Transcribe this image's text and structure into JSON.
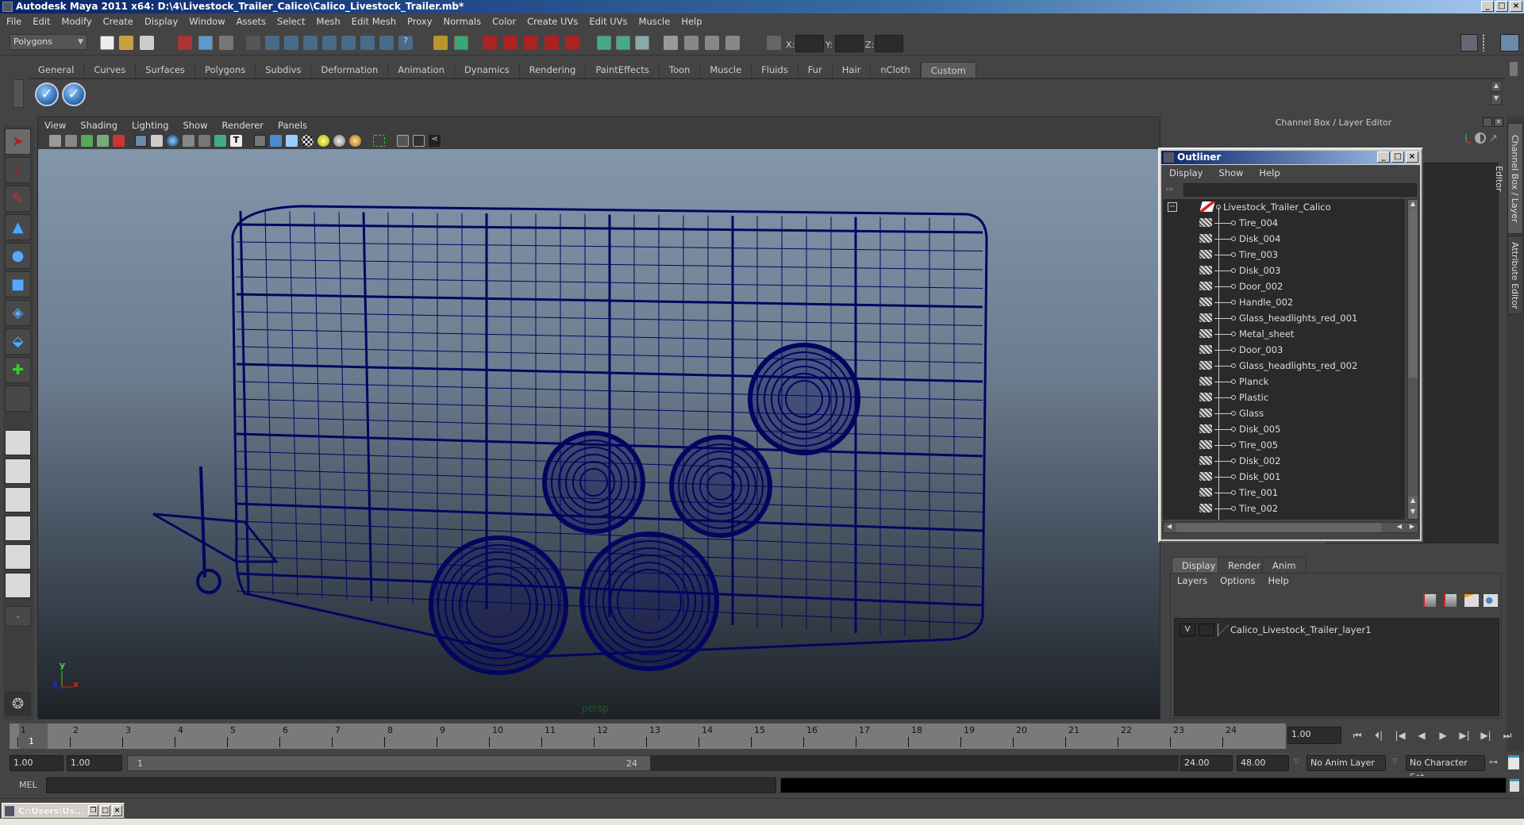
{
  "window": {
    "title": "Autodesk Maya 2011 x64: D:\\4\\Livestock_Trailer_Calico\\Calico_Livestock_Trailer.mb*",
    "controls": [
      "_",
      "□",
      "×"
    ]
  },
  "menubar": [
    "File",
    "Edit",
    "Modify",
    "Create",
    "Display",
    "Window",
    "Assets",
    "Select",
    "Mesh",
    "Edit Mesh",
    "Proxy",
    "Normals",
    "Color",
    "Create UVs",
    "Edit UVs",
    "Muscle",
    "Help"
  ],
  "statusline": {
    "mode": "Polygons",
    "coord_labels": [
      "X:",
      "Y:",
      "Z:"
    ],
    "coord_values": [
      "",
      "",
      ""
    ]
  },
  "shelf": {
    "tabs": [
      "General",
      "Curves",
      "Surfaces",
      "Polygons",
      "Subdivs",
      "Deformation",
      "Animation",
      "Dynamics",
      "Rendering",
      "PaintEffects",
      "Toon",
      "Muscle",
      "Fluids",
      "Fur",
      "Hair",
      "nCloth",
      "Custom"
    ],
    "active_tab": "Custom",
    "icons": [
      "checkmark-shelf-icon",
      "checkmark-shelf-icon"
    ]
  },
  "toolbox": {
    "tools": [
      "select-tool",
      "lasso-tool",
      "paint-select-tool",
      "move-tool",
      "rotate-tool",
      "scale-tool",
      "universal-manipulator",
      "soft-mod-tool",
      "show-manipulator",
      "last-tool"
    ],
    "layouts": [
      "single-perspective-layout",
      "four-view-layout",
      "outliner-persp-layout",
      "persp-graph-layout",
      "hypershade-persp-layout",
      "persp-graph-outliner-layout"
    ]
  },
  "viewport": {
    "menu": [
      "View",
      "Shading",
      "Lighting",
      "Show",
      "Renderer",
      "Panels"
    ],
    "camera_label": "persp",
    "axis": {
      "x": "x",
      "y": "y",
      "z": "z"
    },
    "wireframe_color": "#020660"
  },
  "channelbox": {
    "header": "Channel Box / Layer Editor",
    "side_tabs": [
      "Channel Box / Layer Editor",
      "Attribute Editor"
    ]
  },
  "outliner": {
    "title": "Outliner",
    "menu": [
      "Display",
      "Show",
      "Help"
    ],
    "root": "Livestock_Trailer_Calico",
    "items": [
      "Tire_004",
      "Disk_004",
      "Tire_003",
      "Disk_003",
      "Door_002",
      "Handle_002",
      "Glass_headlights_red_001",
      "Metal_sheet",
      "Door_003",
      "Glass_headlights_red_002",
      "Planck",
      "Plastic",
      "Glass",
      "Disk_005",
      "Tire_005",
      "Disk_002",
      "Disk_001",
      "Tire_001",
      "Tire_002"
    ]
  },
  "layer_editor": {
    "tabs": [
      "Display",
      "Render",
      "Anim"
    ],
    "active_tab": "Display",
    "menu": [
      "Layers",
      "Options",
      "Help"
    ],
    "layers": [
      {
        "visible": "V",
        "name": "Calico_Livestock_Trailer_layer1"
      }
    ]
  },
  "timeline": {
    "ticks": [
      "1",
      "2",
      "3",
      "4",
      "5",
      "6",
      "7",
      "8",
      "9",
      "10",
      "11",
      "12",
      "13",
      "14",
      "15",
      "16",
      "17",
      "18",
      "19",
      "20",
      "21",
      "22",
      "23",
      "24"
    ],
    "current_frame": "1",
    "current_time": "1.00",
    "playback": [
      "go-to-start",
      "step-back-key",
      "step-back-frame",
      "play-backward",
      "play-forward",
      "step-forward-frame",
      "step-forward-key",
      "go-to-end"
    ]
  },
  "range": {
    "start": "1.00",
    "playback_start": "1.00",
    "slider_start": "1",
    "slider_end": "24",
    "playback_end": "24.00",
    "end": "48.00",
    "anim_layer": "No Anim Layer",
    "character_set": "No Character Set"
  },
  "command_line": {
    "label": "MEL",
    "value": ""
  },
  "taskbar": {
    "minimized_window": "C:\\Users\\Us..."
  }
}
